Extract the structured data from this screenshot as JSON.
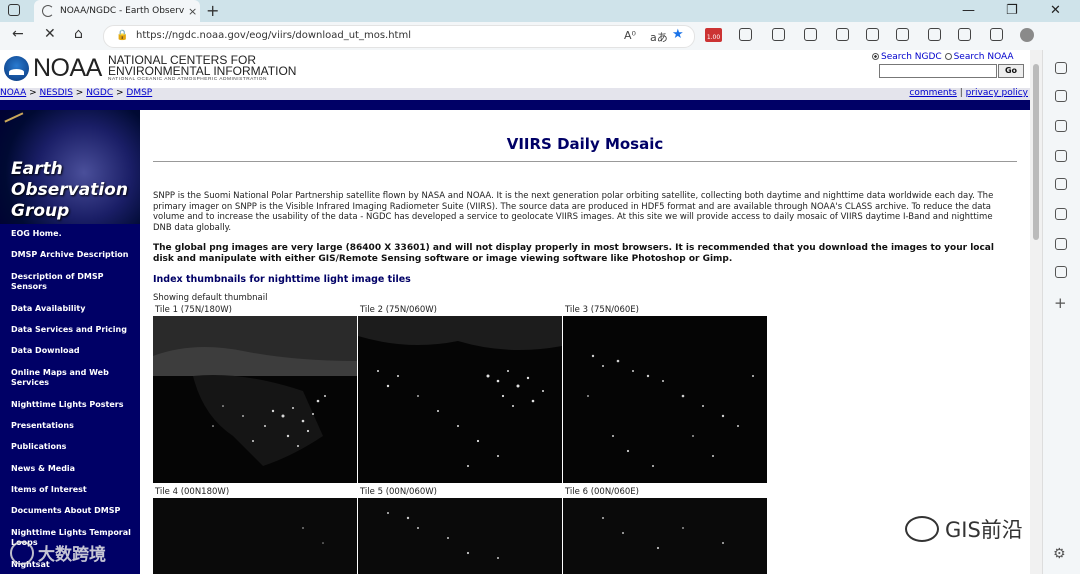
{
  "browser": {
    "tab_title": "NOAA/NGDC - Earth Observation",
    "tab_close": "×",
    "new_tab": "+",
    "window_controls": [
      "—",
      "❐",
      "✕"
    ],
    "nav_buttons": [
      "←",
      "✕",
      "⌂"
    ],
    "url": "https://ngdc.noaa.gov/eog/viirs/download_ut_mos.html",
    "url_icons": [
      "A⁰",
      "aあ",
      "★"
    ],
    "badge": "1.00"
  },
  "header": {
    "logo_text": "NOAA",
    "ncei_line1": "NATIONAL CENTERS FOR",
    "ncei_line2": "ENVIRONMENTAL INFORMATION",
    "ncei_sub": "NATIONAL OCEANIC AND ATMOSPHERIC ADMINISTRATION",
    "search_option1": "Search NGDC",
    "search_option2": "Search NOAA",
    "search_value": "",
    "go_label": "Go"
  },
  "breadcrumbs": [
    "NOAA",
    "NESDIS",
    "NGDC",
    "DMSP"
  ],
  "breadcrumb_sep": " > ",
  "top_links": [
    "comments",
    "privacy policy"
  ],
  "top_link_sep": " | ",
  "sidebar": {
    "hero_title": [
      "Earth",
      "Observation",
      "Group"
    ],
    "items": [
      "EOG Home.",
      "DMSP Archive Description",
      "Description of DMSP Sensors",
      "Data Availability",
      "Data Services and Pricing",
      "Data Download",
      "Online Maps and Web Services",
      "Nighttime Lights Posters",
      "Presentations",
      "Publications",
      "News & Media",
      "Items of Interest",
      "Documents About DMSP",
      "Nighttime Lights Temporal Loops",
      "Nightsat"
    ]
  },
  "main": {
    "title": "VIIRS Daily Mosaic",
    "para1": "SNPP is the Suomi National Polar Partnership satellite flown by NASA and NOAA. It is the next generation polar orbiting satellite, collecting both daytime and nighttime data worldwide each day. The primary imager on SNPP is the Visible Infrared Imaging Radiometer Suite (VIIRS). The source data are produced in HDF5 format and are available through NOAA's CLASS archive. To reduce the data volume and to increase the usability of the data - NGDC has developed a service to geolocate VIIRS images. At this site we will provide access to daily mosaic of VIIRS daytime I-Band and nighttime DNB data globally.",
    "para2": "The global png images are very large (86400 X 33601) and will not display properly in most browsers. It is recommended that you download the images to your local disk and manipulate with either GIS/Remote Sensing software or image viewing software like Photoshop or Gimp.",
    "index_link": "Index thumbnails for nighttime light image tiles",
    "showing": "Showing default thumbnail",
    "tiles": [
      "Tile 1 (75N/180W)",
      "Tile 2 (75N/060W)",
      "Tile 3 (75N/060E)",
      "Tile 4 (00N180W)",
      "Tile 5 (00N/060W)",
      "Tile 6 (00N/060E)"
    ]
  },
  "watermarks": [
    "GIS前沿",
    "大数跨境"
  ]
}
